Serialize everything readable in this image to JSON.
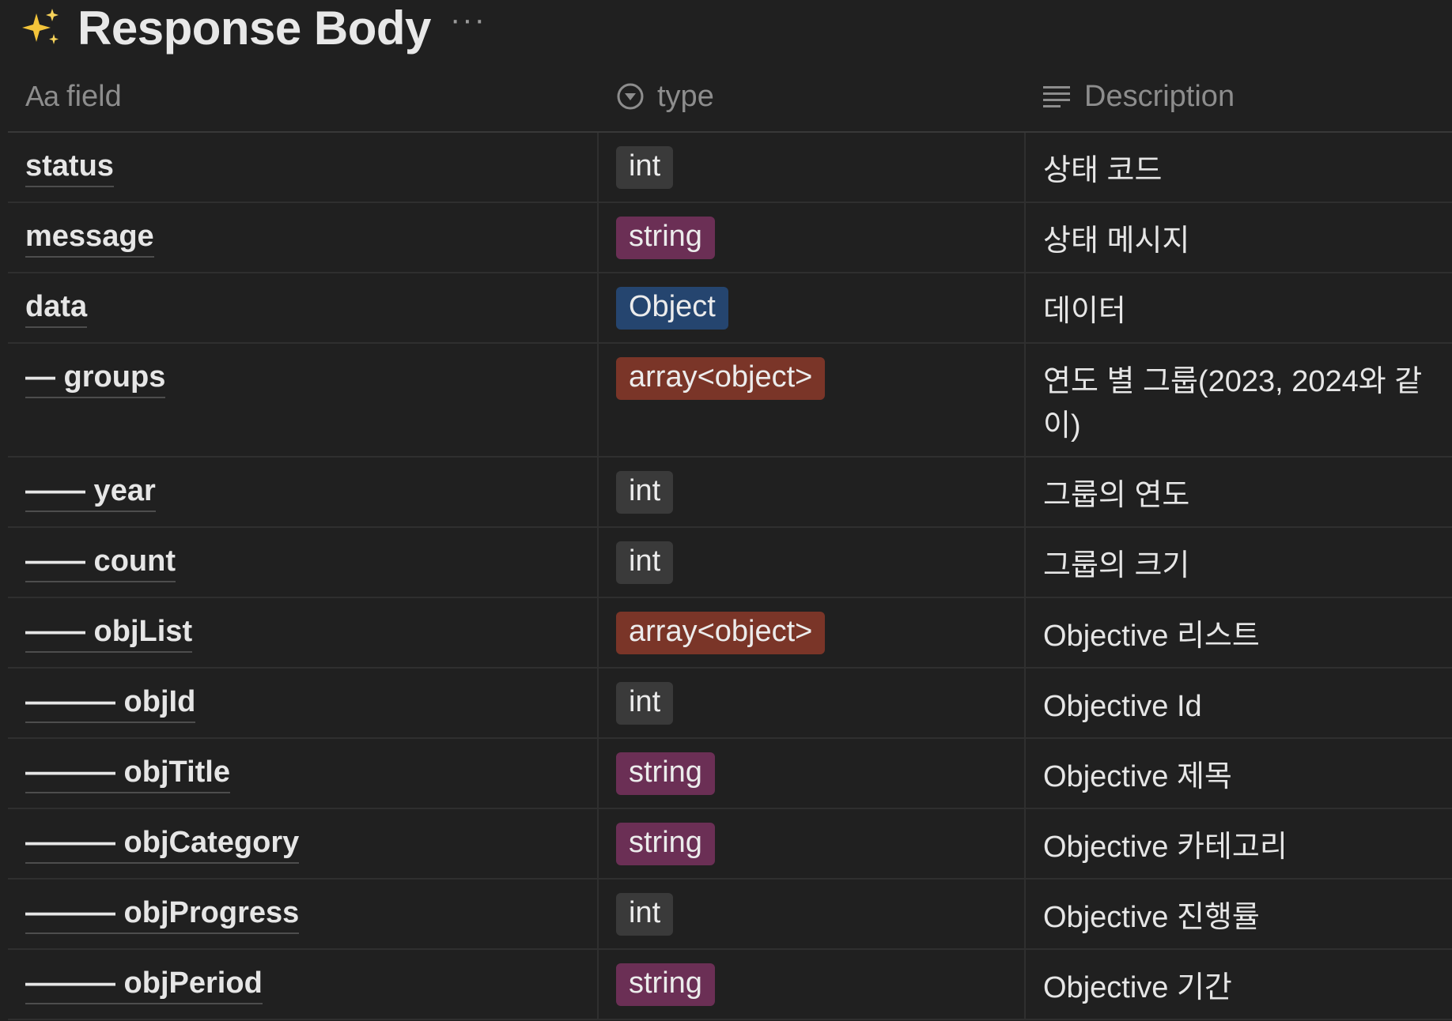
{
  "page": {
    "title": "Response Body",
    "title_icon": "sparkles-icon",
    "more_label": "···"
  },
  "columns": [
    {
      "label": "field",
      "icon_text": "Aa",
      "icon": "text-property-icon"
    },
    {
      "label": "type",
      "icon": "select-property-icon"
    },
    {
      "label": "Description",
      "icon": "text-lines-icon"
    }
  ],
  "type_colors": {
    "int": "#3a3a3a",
    "string": "#6b2f55",
    "Object": "#25456f",
    "array<object>": "#7a3528"
  },
  "rows": [
    {
      "field": "status",
      "type": "int",
      "description": "상태 코드"
    },
    {
      "field": "message",
      "type": "string",
      "description": "상태 메시지"
    },
    {
      "field": "data",
      "type": "Object",
      "description": "데이터"
    },
    {
      "field": "— groups",
      "type": "array<object>",
      "description": "연도 별 그룹(2023, 2024와 같이)"
    },
    {
      "field": "—— year",
      "type": "int",
      "description": "그룹의 연도"
    },
    {
      "field": "—— count",
      "type": "int",
      "description": "그룹의 크기"
    },
    {
      "field": "—— objList",
      "type": "array<object>",
      "description": "Objective 리스트"
    },
    {
      "field": "——— objId",
      "type": "int",
      "description": "Objective Id"
    },
    {
      "field": "——— objTitle",
      "type": "string",
      "description": "Objective 제목"
    },
    {
      "field": "——— objCategory",
      "type": "string",
      "description": "Objective 카테고리"
    },
    {
      "field": "——— objProgress",
      "type": "int",
      "description": "Objective 진행률"
    },
    {
      "field": "——— objPeriod",
      "type": "string",
      "description": "Objective 기간"
    }
  ]
}
